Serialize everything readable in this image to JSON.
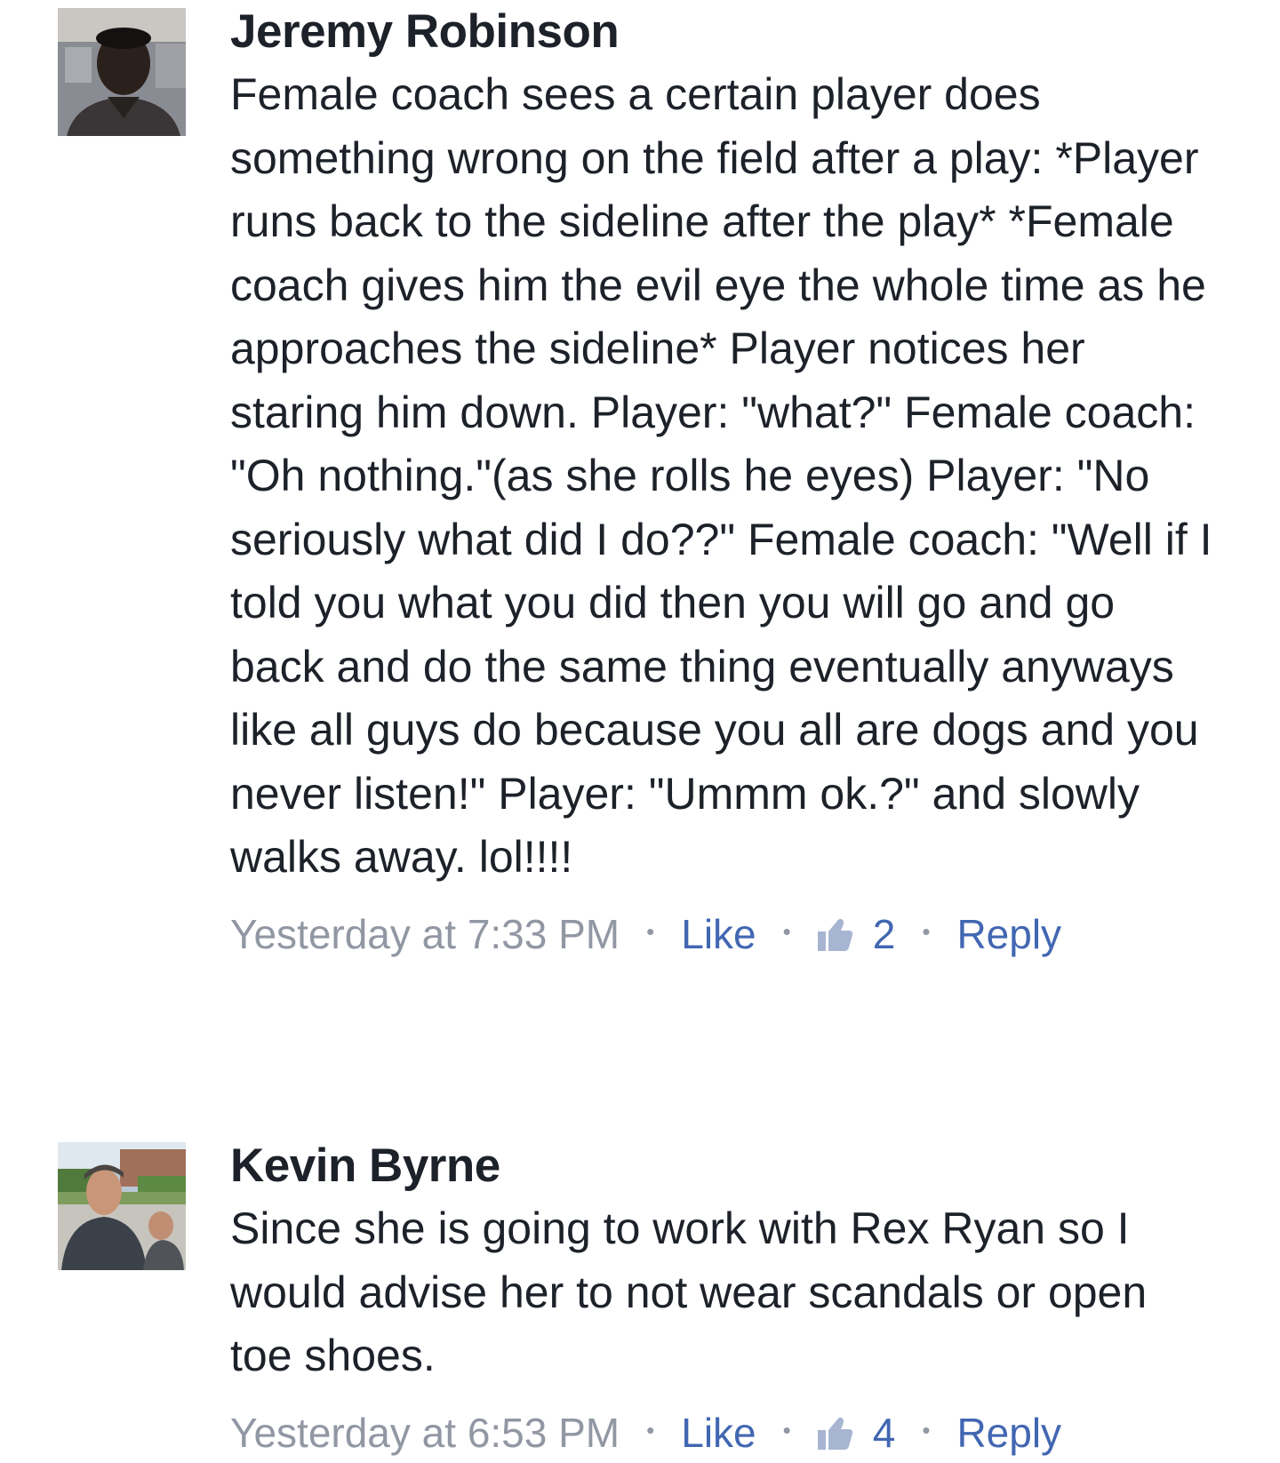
{
  "comments": [
    {
      "author": "Jeremy Robinson",
      "text": "Female coach sees a certain player does something wrong on the field after a play: *Player runs back to the sideline after the play* *Female coach gives him the evil eye the whole time as he approaches the sideline* Player notices her staring him down. Player: \"what?\" Female coach: \"Oh nothing.\"(as she rolls he eyes) Player: \"No seriously what did I do??\" Female coach: \"Well if I told you what you did then you will go and go back and do the same thing eventually anyways like all guys do because you all are dogs and you never listen!\" Player: \"Ummm ok.?\" and slowly walks away. lol!!!!",
      "timestamp": "Yesterday at 7:33 PM",
      "like_label": "Like",
      "like_count": "2",
      "reply_label": "Reply"
    },
    {
      "author": "Kevin Byrne",
      "text": "Since she is going to work with Rex Ryan so I would advise her to not wear scandals or open toe shoes.",
      "timestamp": "Yesterday at 6:53 PM",
      "like_label": "Like",
      "like_count": "4",
      "reply_label": "Reply"
    }
  ],
  "separator": "•",
  "icons": {
    "avatar": "profile-photo",
    "likes": "thumbs-up-icon"
  },
  "colors": {
    "text": "#1d2129",
    "meta": "#9197a3",
    "link": "#4267b2"
  }
}
